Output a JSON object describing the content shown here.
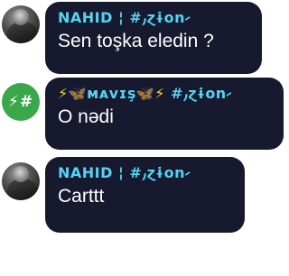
{
  "messages": [
    {
      "author": "NAHID ¦ #⹜ɀɨon⹝",
      "text": "Sen toşka eledin ?",
      "avatar": "photo-avatar"
    },
    {
      "author_parts": {
        "bolt_left": "⚡",
        "butterfly_left": "🦋",
        "name": "ᴍᴀᴠɪş",
        "butterfly_right": "🦋",
        "bolt_right": "⚡",
        "tag": " #⹜ɀɨon⹝"
      },
      "text": "O nədi",
      "avatar": "initials-avatar",
      "avatar_text": "⚡#"
    },
    {
      "author": "NAHID ¦ #⹜ɀɨon⹝",
      "text": "Carttt",
      "avatar": "photo-avatar"
    }
  ],
  "colors": {
    "bubble": "#17192e",
    "name": "#53d4f4",
    "text": "#ffffff",
    "avatar_green": "#3aa84a"
  }
}
